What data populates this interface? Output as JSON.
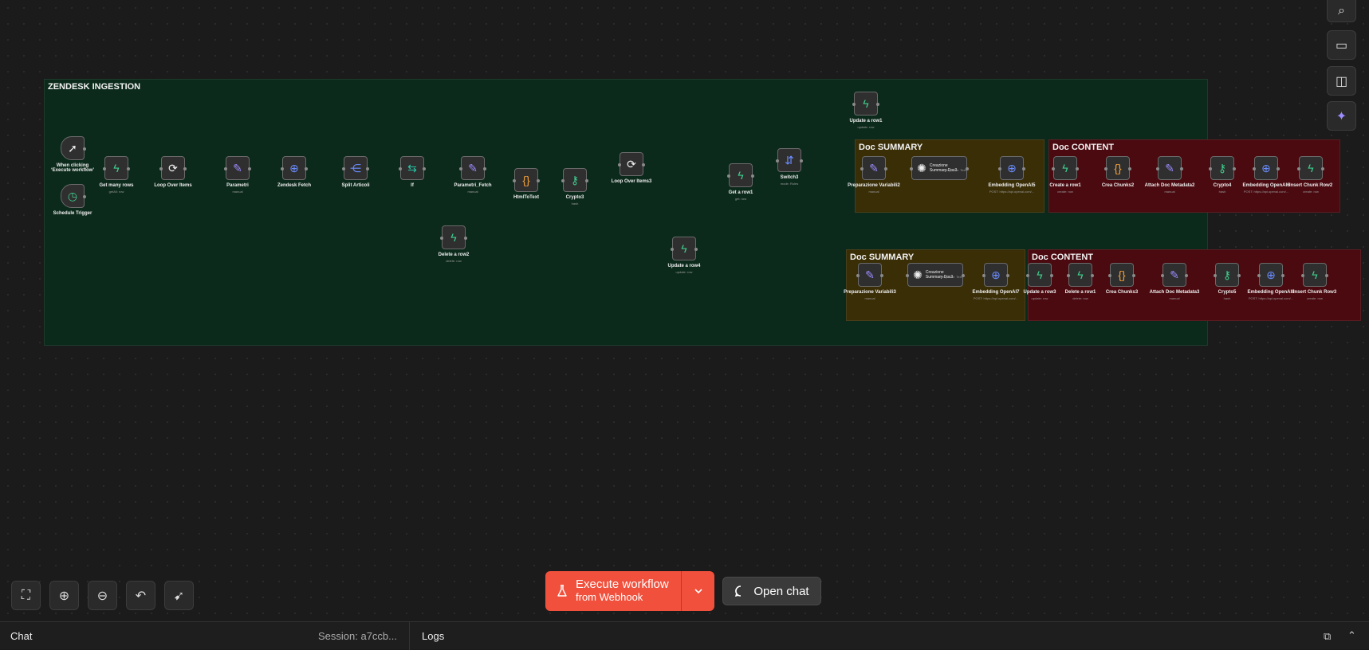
{
  "canvas": {
    "stickies": [
      {
        "id": "ingestion",
        "title": "ZENDESK INGESTION",
        "color": "#0c2a1c"
      },
      {
        "id": "sum1",
        "title": "Doc SUMMARY",
        "color": "#3a2e07"
      },
      {
        "id": "cont1",
        "title": "Doc CONTENT",
        "color": "#4a0a10"
      },
      {
        "id": "sum2",
        "title": "Doc SUMMARY",
        "color": "#3a2e07"
      },
      {
        "id": "cont2",
        "title": "Doc CONTENT",
        "color": "#4a0a10"
      }
    ],
    "nodes": [
      {
        "label": "When clicking ‘Execute workflow’",
        "sub": "",
        "icon": "cursor-icon",
        "glyph": "➚",
        "color": "white",
        "trigger": true
      },
      {
        "label": "Schedule Trigger",
        "sub": "",
        "icon": "clock-icon",
        "glyph": "◷",
        "color": "green",
        "trigger": true
      },
      {
        "label": "Get many rows",
        "sub": "getAll: row",
        "icon": "supabase-icon",
        "glyph": "ϟ",
        "color": "green"
      },
      {
        "label": "Loop Over Items",
        "sub": "",
        "icon": "loop-icon",
        "glyph": "⟳",
        "color": "white"
      },
      {
        "label": "Parametri",
        "sub": "manual",
        "icon": "pencil-icon",
        "glyph": "✎",
        "color": "purple"
      },
      {
        "label": "Zendesk Fetch",
        "sub": "",
        "icon": "globe-icon",
        "glyph": "⊕",
        "color": "blue"
      },
      {
        "label": "Split Articoli",
        "sub": "",
        "icon": "split-icon",
        "glyph": "⋲",
        "color": "blue"
      },
      {
        "label": "If",
        "sub": "",
        "icon": "if-icon",
        "glyph": "⇆",
        "color": "teal"
      },
      {
        "label": "Parametri_Fetch",
        "sub": "manual",
        "icon": "pencil-icon",
        "glyph": "✎",
        "color": "purple"
      },
      {
        "label": "HtmlToText",
        "sub": "",
        "icon": "code-icon",
        "glyph": "{}",
        "color": "orange"
      },
      {
        "label": "Crypto3",
        "sub": "hash",
        "icon": "key-icon",
        "glyph": "⚷",
        "color": "green"
      },
      {
        "label": "Delete a row2",
        "sub": "delete: row",
        "icon": "supabase-icon",
        "glyph": "ϟ",
        "color": "green"
      },
      {
        "label": "Loop Over Items3",
        "sub": "",
        "icon": "loop-icon",
        "glyph": "⟳",
        "color": "white"
      },
      {
        "label": "Update a row4",
        "sub": "update: row",
        "icon": "supabase-icon",
        "glyph": "ϟ",
        "color": "green"
      },
      {
        "label": "Get a row1",
        "sub": "get: row",
        "icon": "supabase-icon",
        "glyph": "ϟ",
        "color": "green"
      },
      {
        "label": "Switch3",
        "sub": "mode: Rules",
        "icon": "switch-icon",
        "glyph": "⇵",
        "color": "blue"
      },
      {
        "label": "Update a row1",
        "sub": "update: row",
        "icon": "supabase-icon",
        "glyph": "ϟ",
        "color": "green"
      },
      {
        "label": "Preparazione Variabili2",
        "sub": "manual",
        "icon": "pencil-icon",
        "glyph": "✎",
        "color": "purple"
      },
      {
        "label": "Creazione Summary Doc3",
        "sub": "Response: Text",
        "icon": "openai-icon",
        "glyph": "✺",
        "color": "white",
        "wide": true
      },
      {
        "label": "Embedding OpenAI5",
        "sub": "POST: https://api.openai.com/...",
        "icon": "globe-icon",
        "glyph": "⊕",
        "color": "blue"
      },
      {
        "label": "Create a row1",
        "sub": "create: row",
        "icon": "supabase-icon",
        "glyph": "ϟ",
        "color": "green"
      },
      {
        "label": "Crea Chunks2",
        "sub": "",
        "icon": "code-icon",
        "glyph": "{}",
        "color": "orange"
      },
      {
        "label": "Attach Doc Metadata2",
        "sub": "manual",
        "icon": "pencil-icon",
        "glyph": "✎",
        "color": "purple"
      },
      {
        "label": "Crypto4",
        "sub": "hash",
        "icon": "key-icon",
        "glyph": "⚷",
        "color": "green"
      },
      {
        "label": "Embedding OpenAI6",
        "sub": "POST: https://api.openai.com/...",
        "icon": "globe-icon",
        "glyph": "⊕",
        "color": "blue"
      },
      {
        "label": "Insert Chunk Row2",
        "sub": "create: row",
        "icon": "supabase-icon",
        "glyph": "ϟ",
        "color": "green"
      },
      {
        "label": "Preparazione Variabili3",
        "sub": "manual",
        "icon": "pencil-icon",
        "glyph": "✎",
        "color": "purple"
      },
      {
        "label": "Creazione Summary Doc3",
        "sub": "Response: Text",
        "icon": "openai-icon",
        "glyph": "✺",
        "color": "white",
        "wide": true
      },
      {
        "label": "Embedding OpenAI7",
        "sub": "POST: https://api.openai.com/...",
        "icon": "globe-icon",
        "glyph": "⊕",
        "color": "blue"
      },
      {
        "label": "Update a row3",
        "sub": "update: row",
        "icon": "supabase-icon",
        "glyph": "ϟ",
        "color": "green"
      },
      {
        "label": "Delete a row1",
        "sub": "delete: row",
        "icon": "supabase-icon",
        "glyph": "ϟ",
        "color": "green"
      },
      {
        "label": "Crea Chunks3",
        "sub": "",
        "icon": "code-icon",
        "glyph": "{}",
        "color": "orange"
      },
      {
        "label": "Attach Doc Metadata3",
        "sub": "manual",
        "icon": "pencil-icon",
        "glyph": "✎",
        "color": "purple"
      },
      {
        "label": "Crypto5",
        "sub": "hash",
        "icon": "key-icon",
        "glyph": "⚷",
        "color": "green"
      },
      {
        "label": "Embedding OpenAI8",
        "sub": "POST: https://api.openai.com/...",
        "icon": "globe-icon",
        "glyph": "⊕",
        "color": "blue"
      },
      {
        "label": "Insert Chunk Row3",
        "sub": "create: row",
        "icon": "supabase-icon",
        "glyph": "ϟ",
        "color": "green"
      }
    ]
  },
  "side_toolbar": [
    {
      "name": "search-button",
      "icon": "search-icon",
      "glyph": "⌕"
    },
    {
      "name": "sticky-note-button",
      "icon": "sticky-note-icon",
      "glyph": "▭"
    },
    {
      "name": "panel-toggle-button",
      "icon": "panel-icon",
      "glyph": "◫"
    },
    {
      "name": "ai-assistant-button",
      "icon": "sparkles-icon",
      "glyph": "✦"
    }
  ],
  "canvas_controls": [
    {
      "name": "fit-view-button",
      "icon": "fit-view-icon",
      "glyph": "⛶"
    },
    {
      "name": "zoom-in-button",
      "icon": "zoom-in-icon",
      "glyph": "⊕"
    },
    {
      "name": "zoom-out-button",
      "icon": "zoom-out-icon",
      "glyph": "⊖"
    },
    {
      "name": "undo-button",
      "icon": "undo-icon",
      "glyph": "↶"
    },
    {
      "name": "tidy-up-button",
      "icon": "broom-icon",
      "glyph": "➹"
    }
  ],
  "execute": {
    "title": "Execute workflow",
    "subtitle": "from Webhook",
    "icon": "flask-icon"
  },
  "open_chat": {
    "label": "Open chat",
    "icon": "chat-bubble-icon"
  },
  "bottom_bar": {
    "chat": "Chat",
    "session": "Session: a7ccb...",
    "logs": "Logs"
  },
  "colors": {
    "execute": "#f0503c",
    "background": "#1b1b1b"
  }
}
